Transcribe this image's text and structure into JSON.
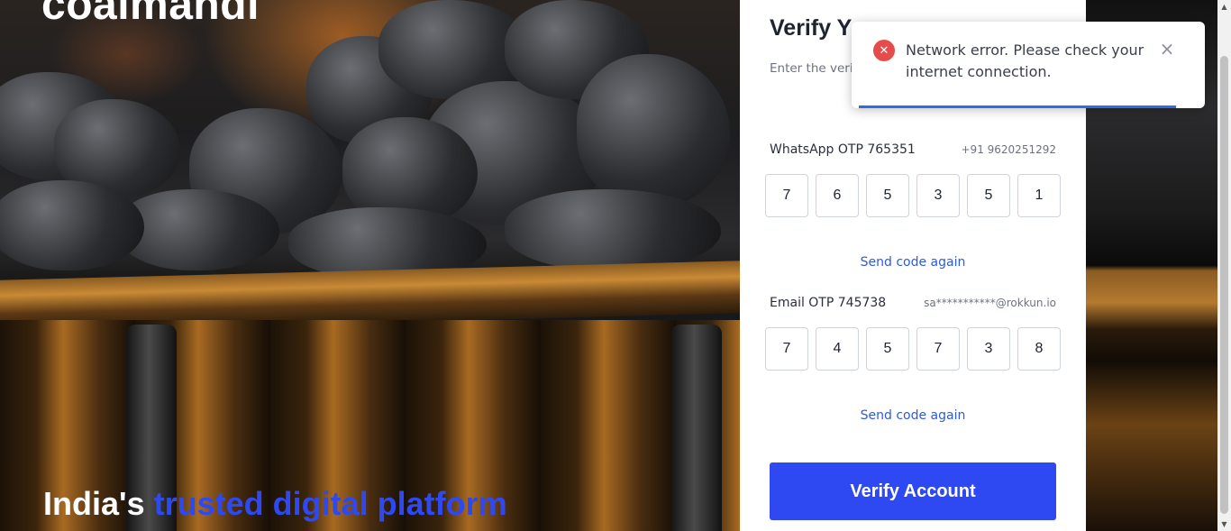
{
  "brand": {
    "name": "coalmandi"
  },
  "hero": {
    "tagline_prefix": "India's",
    "tagline_accent": "trusted digital platform"
  },
  "form": {
    "title": "Verify Y",
    "description": "Enter the veri WhatsApp ar account setup.",
    "whatsapp": {
      "label": "WhatsApp OTP 765351",
      "contact": "+91 9620251292",
      "digits": [
        "7",
        "6",
        "5",
        "3",
        "5",
        "1"
      ],
      "resend_label": "Send code again"
    },
    "email": {
      "label": "Email OTP 745738",
      "contact": "sa***********@rokkun.io",
      "digits": [
        "7",
        "4",
        "5",
        "7",
        "3",
        "8"
      ],
      "resend_label": "Send code again"
    },
    "submit_label": "Verify Account"
  },
  "toast": {
    "message": "Network error. Please check your internet connection.",
    "icon": "error-x-icon",
    "close_icon": "close-icon"
  },
  "colors": {
    "accent": "#2f49f2",
    "error": "#e74c4c",
    "link": "#2f5bd8"
  }
}
